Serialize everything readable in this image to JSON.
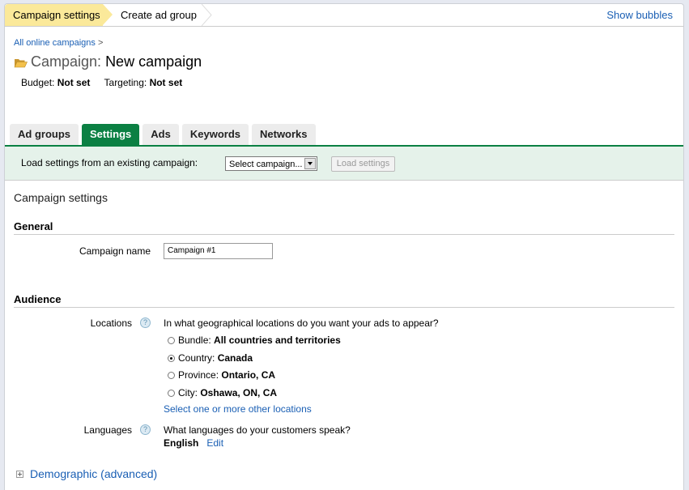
{
  "wizard": {
    "steps": [
      {
        "label": "Campaign settings",
        "active": true
      },
      {
        "label": "Create ad group",
        "active": false
      }
    ],
    "show_bubbles": "Show bubbles"
  },
  "breadcrumb": {
    "link": "All online campaigns",
    "separator": ">"
  },
  "header": {
    "icon": "folder-open-icon",
    "prefix": "Campaign:",
    "name": "New campaign",
    "budget_label": "Budget:",
    "budget_value": "Not set",
    "targeting_label": "Targeting:",
    "targeting_value": "Not set"
  },
  "tabs": [
    {
      "label": "Ad groups",
      "active": false
    },
    {
      "label": "Settings",
      "active": true
    },
    {
      "label": "Ads",
      "active": false
    },
    {
      "label": "Keywords",
      "active": false
    },
    {
      "label": "Networks",
      "active": false
    }
  ],
  "load_bar": {
    "label": "Load settings from an existing campaign:",
    "select_value": "Select campaign...",
    "button": "Load settings"
  },
  "section_title": "Campaign settings",
  "general": {
    "heading": "General",
    "campaign_name_label": "Campaign name",
    "campaign_name_value": "Campaign #1"
  },
  "audience": {
    "heading": "Audience",
    "locations": {
      "label": "Locations",
      "question": "In what geographical locations do you want your ads to appear?",
      "options": [
        {
          "type": "Bundle:",
          "value": "All countries and territories",
          "selected": false
        },
        {
          "type": "Country:",
          "value": "Canada",
          "selected": true
        },
        {
          "type": "Province:",
          "value": "Ontario, CA",
          "selected": false
        },
        {
          "type": "City:",
          "value": "Oshawa, ON, CA",
          "selected": false
        }
      ],
      "other_link": "Select one or more other locations"
    },
    "languages": {
      "label": "Languages",
      "question": "What languages do your customers speak?",
      "value": "English",
      "edit": "Edit"
    },
    "demographic": "Demographic (advanced)"
  },
  "colors": {
    "accent_green": "#0b8043",
    "link_blue": "#1a5fb4",
    "wizard_active": "#fbe99a",
    "load_bar_bg": "#e5f2ea"
  }
}
